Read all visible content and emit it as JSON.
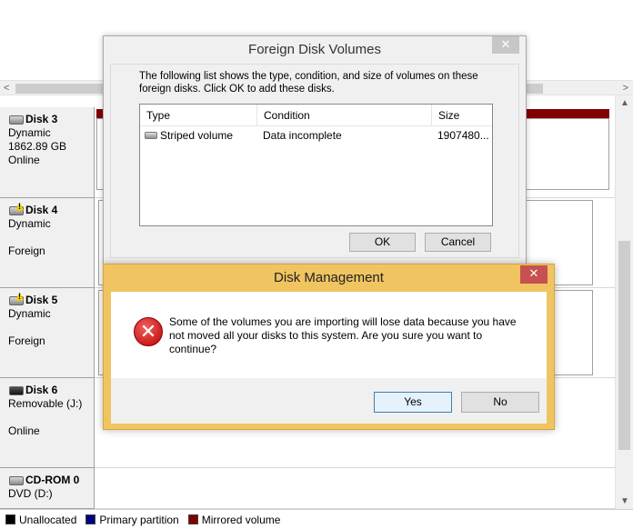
{
  "disks": [
    {
      "name": "Disk 3",
      "type": "Dynamic",
      "size": "1862.89 GB",
      "status": "Online",
      "icon": "disk-icon"
    },
    {
      "name": "Disk 4",
      "type": "Dynamic",
      "size": "",
      "status": "Foreign",
      "icon": "foreign-disk-icon"
    },
    {
      "name": "Disk 5",
      "type": "Dynamic",
      "size": "",
      "status": "Foreign",
      "icon": "foreign-disk-icon"
    },
    {
      "name": "Disk 6",
      "type": "Removable (J:)",
      "size": "",
      "status": "Online",
      "icon": "removable-disk-icon"
    },
    {
      "name": "CD-ROM 0",
      "type": "DVD (D:)",
      "size": "",
      "status": "",
      "icon": "cdrom-icon"
    }
  ],
  "legend": [
    {
      "label": "Unallocated",
      "color": "#000000"
    },
    {
      "label": "Primary partition",
      "color": "#000080"
    },
    {
      "label": "Mirrored volume",
      "color": "#800000"
    }
  ],
  "foreign_dialog": {
    "title": "Foreign Disk Volumes",
    "close_glyph": "✕",
    "description": "The following list shows the type, condition, and size of volumes on these foreign disks. Click OK to add these disks.",
    "columns": [
      "Type",
      "Condition",
      "Size"
    ],
    "rows": [
      {
        "type": "Striped volume",
        "condition": "Data incomplete",
        "size": "1907480..."
      }
    ],
    "ok_label": "OK",
    "cancel_label": "Cancel"
  },
  "error_dialog": {
    "title": "Disk Management",
    "close_glyph": "✕",
    "icon_glyph": "✕",
    "message": "Some of the volumes you are importing will lose data because you have not moved all your disks to this system. Are you sure you want to continue?",
    "yes_label": "Yes",
    "no_label": "No"
  },
  "colors": {
    "mirrored": "#800000",
    "error_title_bar": "#f0c460",
    "close_red": "#c75050"
  }
}
